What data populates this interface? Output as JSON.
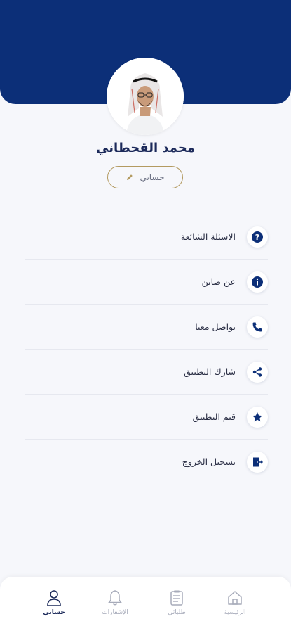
{
  "profile": {
    "name": "محمد القحطاني",
    "account_button": "حسابي",
    "avatar": "user-photo"
  },
  "colors": {
    "primary": "#0c2f78",
    "gold": "#b39a60",
    "background": "#f6f7fb"
  },
  "menu": [
    {
      "label": "الاسئلة الشائعة",
      "icon": "question-icon"
    },
    {
      "label": "عن صاين",
      "icon": "info-icon"
    },
    {
      "label": "تواصل معنا",
      "icon": "phone-icon"
    },
    {
      "label": "شارك التطبيق",
      "icon": "share-icon"
    },
    {
      "label": "قيم التطبيق",
      "icon": "star-icon"
    },
    {
      "label": "تسجيل الخروج",
      "icon": "logout-icon"
    }
  ],
  "tabs": [
    {
      "label": "حسابي",
      "icon": "person-icon",
      "active": true
    },
    {
      "label": "الإشعارات",
      "icon": "bell-icon",
      "active": false
    },
    {
      "label": "طلباتي",
      "icon": "orders-icon",
      "active": false
    },
    {
      "label": "الرئيسية",
      "icon": "home-icon",
      "active": false
    }
  ]
}
